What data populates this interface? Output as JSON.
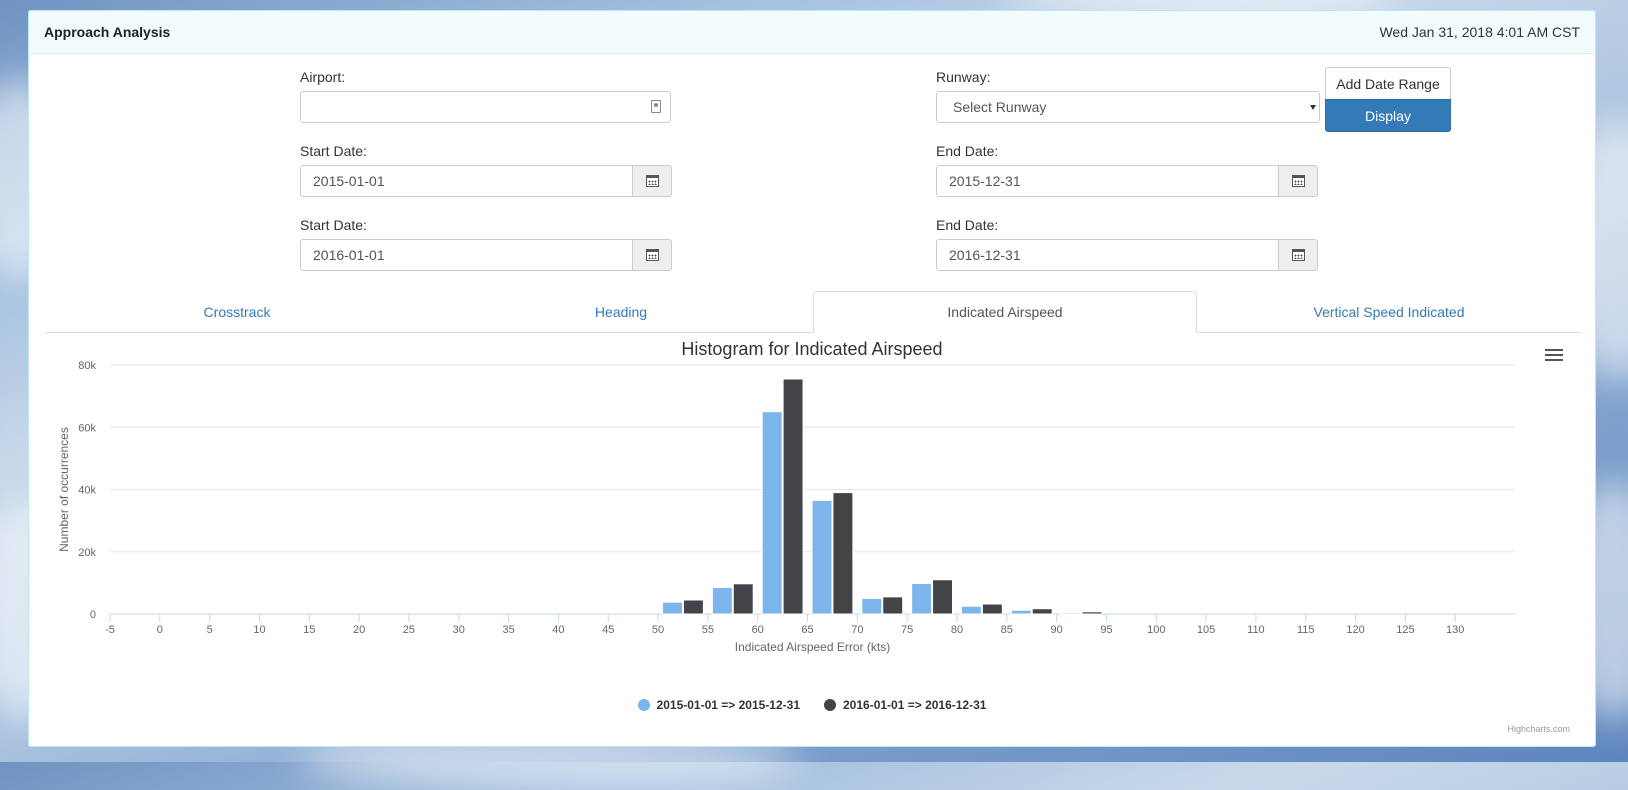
{
  "header": {
    "title": "Approach Analysis",
    "datetime": "Wed Jan 31, 2018 4:01 AM CST"
  },
  "form": {
    "airport_label": "Airport:",
    "airport_value": "",
    "runway_label": "Runway:",
    "runway_value": "Select Runway",
    "add_range_label": "Add Date Range",
    "display_label": "Display",
    "ranges": [
      {
        "start_label": "Start Date:",
        "start": "2015-01-01",
        "end_label": "End Date:",
        "end": "2015-12-31"
      },
      {
        "start_label": "Start Date:",
        "start": "2016-01-01",
        "end_label": "End Date:",
        "end": "2016-12-31"
      }
    ]
  },
  "tabs": [
    {
      "label": "Crosstrack",
      "active": false
    },
    {
      "label": "Heading",
      "active": false
    },
    {
      "label": "Indicated Airspeed",
      "active": true
    },
    {
      "label": "Vertical Speed Indicated",
      "active": false
    }
  ],
  "chart_data": {
    "type": "bar",
    "title": "Histogram for Indicated Airspeed",
    "xlabel": "Indicated Airspeed Error (kts)",
    "ylabel": "Number of occurrences",
    "x_ticks": [
      "-5",
      "0",
      "5",
      "10",
      "15",
      "20",
      "25",
      "30",
      "35",
      "40",
      "45",
      "50",
      "55",
      "60",
      "65",
      "70",
      "75",
      "80",
      "85",
      "90",
      "95",
      "100",
      "105",
      "110",
      "115",
      "120",
      "125",
      "130"
    ],
    "y_ticks": [
      "0",
      "20k",
      "40k",
      "60k",
      "80k"
    ],
    "ylim": [
      0,
      80000
    ],
    "grid": true,
    "legend_position": "bottom",
    "categories": [
      52.5,
      57.5,
      62.5,
      67.5,
      72.5,
      77.5,
      82.5,
      87.5,
      92.5
    ],
    "series": [
      {
        "name": "2015-01-01 => 2015-12-31",
        "color": "#7cb5ec",
        "values": [
          3800,
          8500,
          65000,
          36500,
          5000,
          9800,
          2500,
          1200,
          400
        ]
      },
      {
        "name": "2016-01-01 => 2016-12-31",
        "color": "#434348",
        "values": [
          4500,
          9700,
          75500,
          39000,
          5500,
          11000,
          3200,
          1700,
          700
        ]
      }
    ],
    "credits": "Highcharts.com"
  }
}
